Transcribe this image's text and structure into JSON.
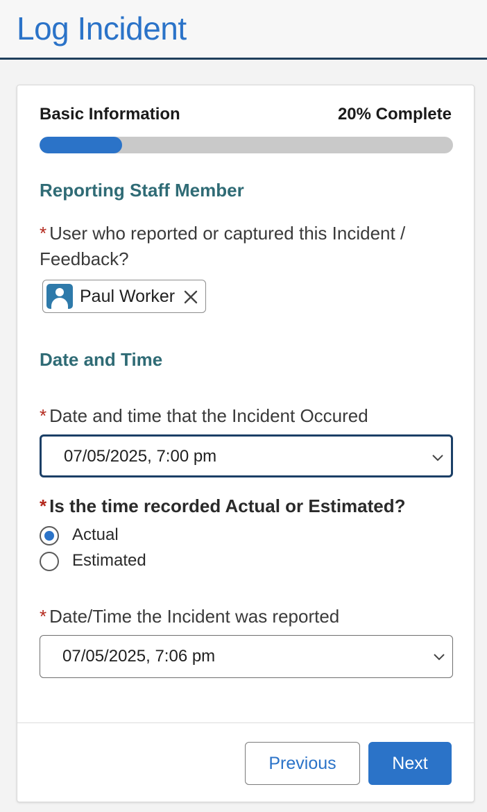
{
  "header": {
    "title": "Log Incident"
  },
  "progress": {
    "step_name": "Basic Information",
    "complete_text": "20% Complete",
    "percent": 20,
    "bar_color": "#2b73c8"
  },
  "sections": {
    "reporting": {
      "heading": "Reporting Staff Member"
    },
    "datetime": {
      "heading": "Date and Time"
    }
  },
  "required_marker": "*",
  "fields": {
    "reporter": {
      "label": "User who reported or captured this Incident / Feedback?",
      "selected_user": "Paul Worker",
      "icon": "user-avatar-icon"
    },
    "occurred": {
      "label": "Date and time that the Incident Occured",
      "value": "07/05/2025, 7:00 pm"
    },
    "time_type": {
      "label": "Is the time recorded Actual or Estimated?",
      "options": [
        "Actual",
        "Estimated"
      ],
      "selected": "Actual"
    },
    "reported": {
      "label": "Date/Time the Incident was reported",
      "value": "07/05/2025, 7:06 pm"
    }
  },
  "buttons": {
    "previous": "Previous",
    "next": "Next"
  },
  "colors": {
    "accent": "#2b73c8",
    "heading": "#2f6b75",
    "required": "#b3281c"
  }
}
